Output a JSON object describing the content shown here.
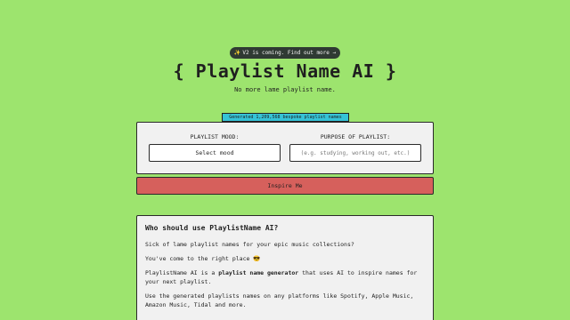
{
  "announcement": {
    "icon": "sparkles-icon",
    "text": "V2 is coming. Find out more →"
  },
  "header": {
    "title": "{ Playlist Name AI }",
    "subtitle": "No more lame playlist name."
  },
  "counter_badge": "Generated 1,209,568 bespoke playlist names",
  "form": {
    "mood_label": "PLAYLIST MOOD:",
    "mood_value": "Select mood",
    "purpose_label": "PURPOSE OF PLAYLIST:",
    "purpose_placeholder": "(e.g. studying, working out, etc.)"
  },
  "cta": {
    "label": "Inspire Me"
  },
  "info": {
    "heading": "Who should use PlaylistName AI?",
    "p1": "Sick of lame playlist names for your epic music collections?",
    "p2": "You've come to the right place 😎",
    "p3_pre": "PlaylistName AI is a ",
    "p3_bold": "playlist name generator",
    "p3_post": " that uses AI to inspire names for your next playlist.",
    "p4": "Use the generated playlists names on any platforms like Spotify, Apple Music, Amazon Music, Tidal and more."
  },
  "colors": {
    "background": "#9de46e",
    "badge": "#35c3d7",
    "button": "#d6605c",
    "card": "#f1f1f1",
    "announce": "#2f3a33"
  }
}
